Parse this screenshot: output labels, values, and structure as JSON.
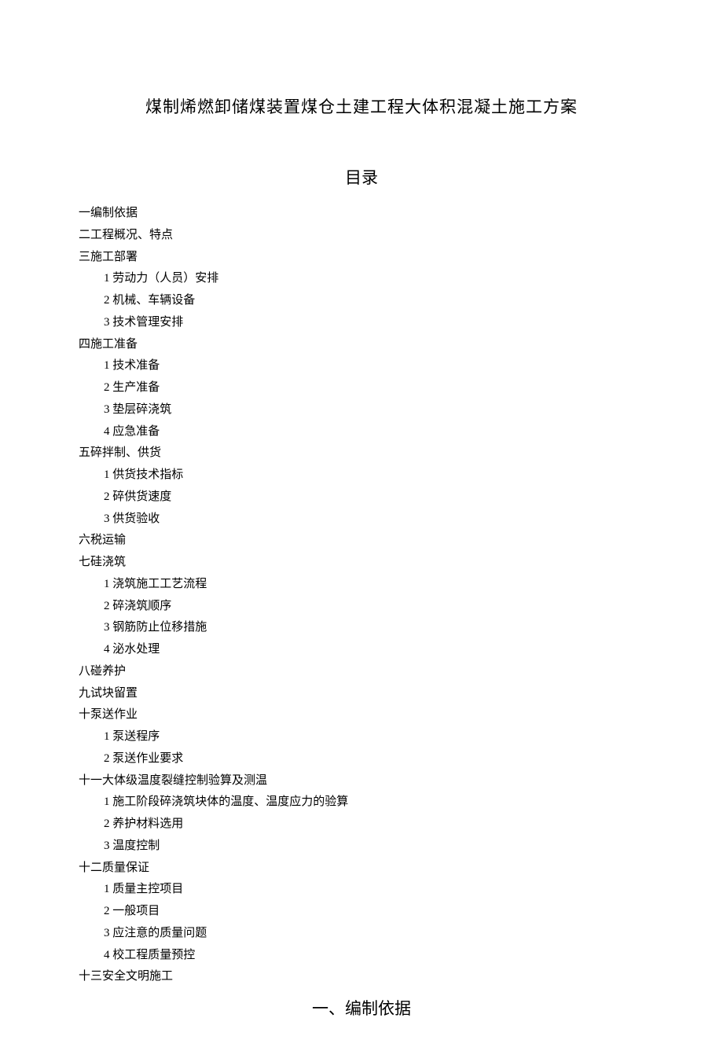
{
  "title": "煤制烯燃卸储煤装置煤仓土建工程大体积混凝土施工方案",
  "toc_heading": "目录",
  "toc": [
    {
      "level": 1,
      "text": "一编制依据"
    },
    {
      "level": 1,
      "text": "二工程概况、特点"
    },
    {
      "level": 1,
      "text": "三施工部署"
    },
    {
      "level": 2,
      "text": "1 劳动力（人员）安排"
    },
    {
      "level": 2,
      "text": "2 机械、车辆设备"
    },
    {
      "level": 2,
      "text": "3 技术管理安排"
    },
    {
      "level": 1,
      "text": "四施工准备"
    },
    {
      "level": 2,
      "text": "1 技术准备"
    },
    {
      "level": 2,
      "text": "2 生产准备"
    },
    {
      "level": 2,
      "text": "3 垫层碎浇筑"
    },
    {
      "level": 2,
      "text": "4 应急准备"
    },
    {
      "level": 1,
      "text": "五碎拌制、供货"
    },
    {
      "level": 2,
      "text": "1 供货技术指标"
    },
    {
      "level": 2,
      "text": "2 碎供货速度"
    },
    {
      "level": 2,
      "text": "3 供货验收"
    },
    {
      "level": 1,
      "text": "六税运输"
    },
    {
      "level": 1,
      "text": "七硅浇筑"
    },
    {
      "level": 2,
      "text": "1 浇筑施工工艺流程"
    },
    {
      "level": 2,
      "text": "2 碎浇筑顺序"
    },
    {
      "level": 2,
      "text": "3 钢筋防止位移措施"
    },
    {
      "level": 2,
      "text": "4 泌水处理"
    },
    {
      "level": 1,
      "text": "八碰养护"
    },
    {
      "level": 1,
      "text": "九试块留置"
    },
    {
      "level": 1,
      "text": "十泵送作业"
    },
    {
      "level": 2,
      "text": "1 泵送程序"
    },
    {
      "level": 2,
      "text": "2 泵送作业要求"
    },
    {
      "level": 1,
      "text": "十一大体级温度裂缝控制验算及测温"
    },
    {
      "level": 2,
      "text": "1 施工阶段碎浇筑块体的温度、温度应力的验算"
    },
    {
      "level": 2,
      "text": "2 养护材料选用"
    },
    {
      "level": 2,
      "text": "3 温度控制"
    },
    {
      "level": 1,
      "text": "十二质量保证"
    },
    {
      "level": 2,
      "text": "1 质量主控项目"
    },
    {
      "level": 2,
      "text": "2 一般项目"
    },
    {
      "level": 2,
      "text": "3 应注意的质量问题"
    },
    {
      "level": 2,
      "text": "4 校工程质量预控"
    },
    {
      "level": 1,
      "text": "十三安全文明施工"
    }
  ],
  "section_heading": "一、编制依据"
}
